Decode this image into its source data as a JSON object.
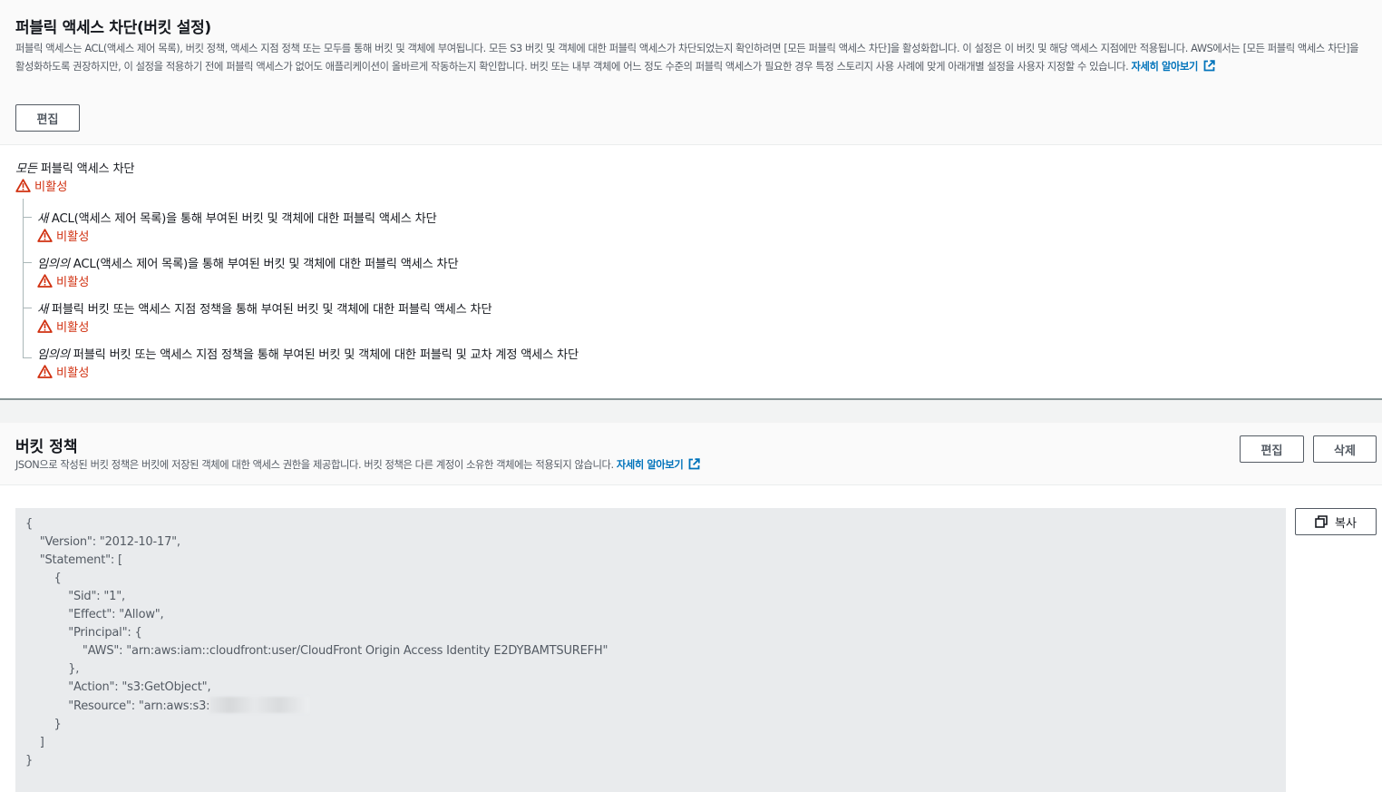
{
  "block_public_access": {
    "title": "퍼블릭 액세스 차단(버킷 설정)",
    "description_lines": [
      "퍼블릭 액세스는 ACL(액세스 제어 목록), 버킷 정책, 액세스 지점 정책 또는 모두를 통해 버킷 및 객체에 부여됩니다. 모든 S3 버킷 및 객체에 대한 퍼블릭 액세스가 차단되었는지 확인하려면 [모든 퍼블릭 액세스 차단]을 활성화합니다. 이 설정은 이 버킷 및 해당 액세스 지점에만 적용됩",
      "니다. AWS에서는 [모든 퍼블릭 액세스 차단]을 활성화하도록 권장하지만, 이 설정을 적용하기 전에 퍼블릭 액세스가 없어도 애플리케이션이 올바르게 작동하는지 확인합니다. 버킷 또는 내부 객체에 어느 정도 수준의 퍼블릭 액세스가 필요한 경우 특정 스토리지 사용 사례에 맞게 아래",
      "개별 설정을 사용자 지정할 수 있습니다."
    ],
    "learn_more": "자세히 알아보기",
    "edit_label": "편집",
    "main_setting": {
      "em": "모든",
      "rest": " 퍼블릭 액세스 차단",
      "status": "비활성"
    },
    "sub_settings": [
      {
        "em": "새",
        "rest": " ACL(액세스 제어 목록)을 통해 부여된 버킷 및 객체에 대한 퍼블릭 액세스 차단",
        "status": "비활성"
      },
      {
        "em": "임의의",
        "rest": " ACL(액세스 제어 목록)을 통해 부여된 버킷 및 객체에 대한 퍼블릭 액세스 차단",
        "status": "비활성"
      },
      {
        "em": "새",
        "rest": " 퍼블릭 버킷 또는 액세스 지점 정책을 통해 부여된 버킷 및 객체에 대한 퍼블릭 액세스 차단",
        "status": "비활성"
      },
      {
        "em": "임의의",
        "rest": " 퍼블릭 버킷 또는 액세스 지점 정책을 통해 부여된 버킷 및 객체에 대한 퍼블릭 및 교차 계정 액세스 차단",
        "status": "비활성"
      }
    ]
  },
  "bucket_policy": {
    "title": "버킷 정책",
    "description": "JSON으로 작성된 버킷 정책은 버킷에 저장된 객체에 대한 액세스 권한을 제공합니다. 버킷 정책은 다른 계정이 소유한 객체에는 적용되지 않습니다.",
    "learn_more": "자세히 알아보기",
    "edit_label": "편집",
    "delete_label": "삭제",
    "copy_label": "복사",
    "code_lines": [
      "{",
      "    \"Version\": \"2012-10-17\",",
      "    \"Statement\": [",
      "        {",
      "            \"Sid\": \"1\",",
      "            \"Effect\": \"Allow\",",
      "            \"Principal\": {",
      "                \"AWS\": \"arn:aws:iam::cloudfront:user/CloudFront Origin Access Identity E2DYBAMTSUREFH\"",
      "            },",
      "            \"Action\": \"s3:GetObject\",",
      "            \"Resource\": \"arn:aws:s3:",
      "        }",
      "    ]",
      "}"
    ]
  },
  "colors": {
    "link": "#0073bb",
    "warning": "#d13212",
    "header_bg": "#fafafa",
    "code_bg": "#e9ebed"
  },
  "icons": [
    "external-link-icon",
    "warning-icon",
    "copy-icon"
  ]
}
